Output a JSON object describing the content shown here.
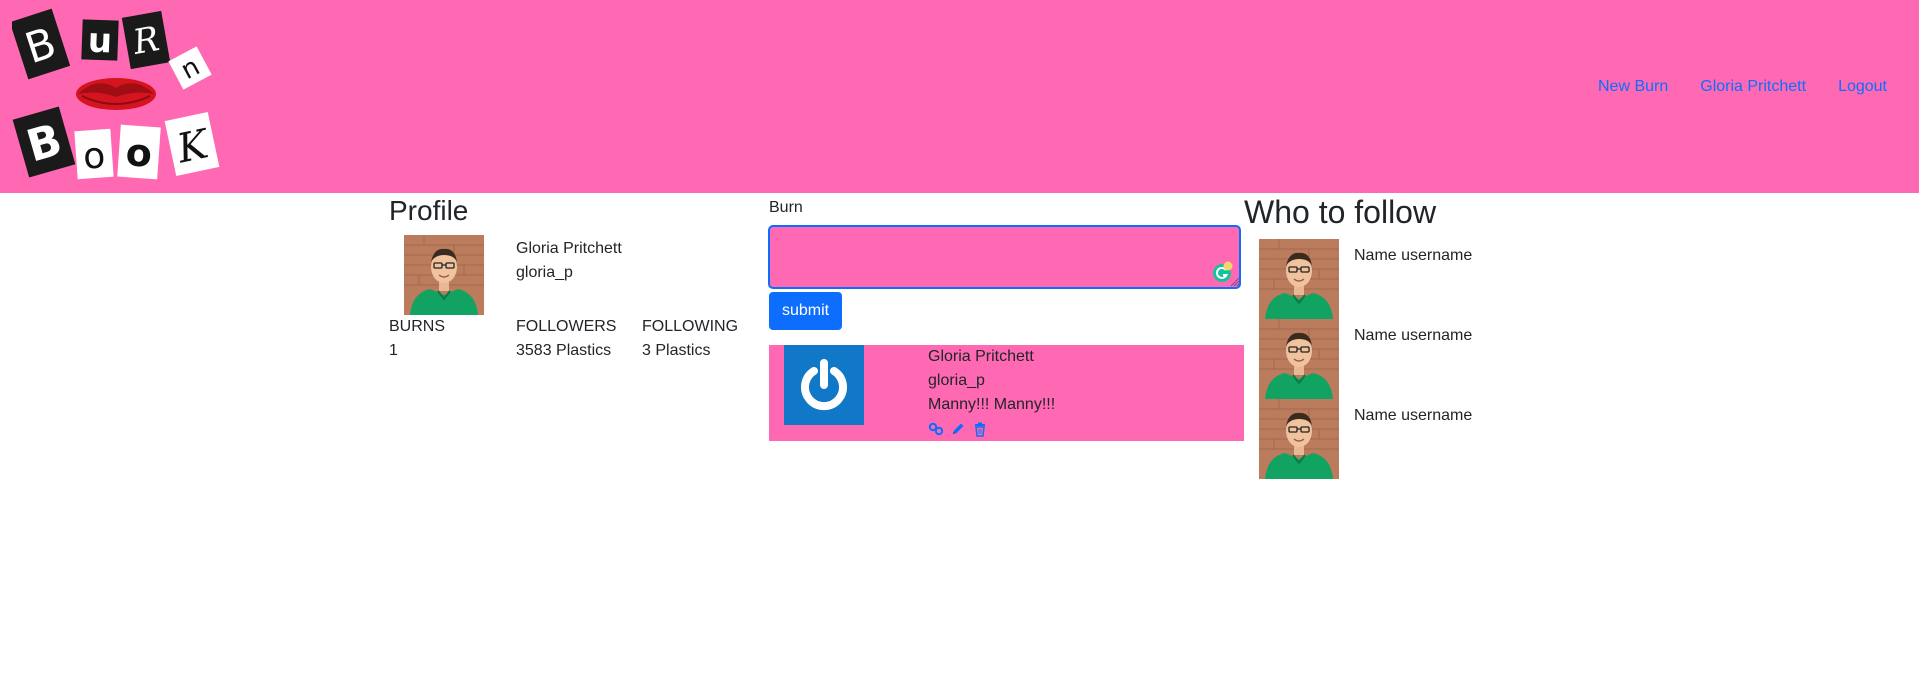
{
  "nav": {
    "logo_letters": [
      "B",
      "u",
      "R",
      "n",
      "B",
      "o",
      "o",
      "K"
    ],
    "links": [
      "New Burn",
      "Gloria Pritchett",
      "Logout"
    ],
    "brand_color": "#ff69b4",
    "link_color": "#0d6efd"
  },
  "profile": {
    "title": "Profile",
    "name": "Gloria Pritchett",
    "username": "gloria_p",
    "stats": [
      {
        "label": "BURNS",
        "value": "1"
      },
      {
        "label": "FOLLOWERS",
        "value": "3583 Plastics"
      },
      {
        "label": "FOLLOWING",
        "value": "3 Plastics"
      }
    ]
  },
  "composer": {
    "label": "Burn",
    "value": "",
    "submit_label": "submit"
  },
  "feed": [
    {
      "name": "Gloria Pritchett",
      "username": "gloria_p",
      "text": "Manny!!! Manny!!!",
      "icons": [
        "link-icon",
        "pencil-icon",
        "trash-icon"
      ]
    }
  ],
  "who_to_follow": {
    "title": "Who to follow",
    "items": [
      "Name username",
      "Name username",
      "Name username"
    ]
  }
}
